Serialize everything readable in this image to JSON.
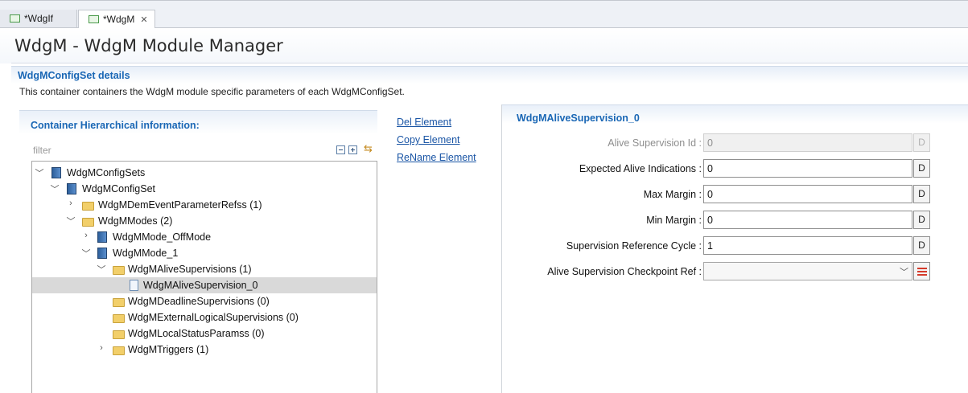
{
  "tabs": [
    {
      "label": "*WdgIf",
      "active": false
    },
    {
      "label": "*WdgM",
      "active": true
    }
  ],
  "page_title": "WdgM - WdgM Module Manager",
  "section": {
    "title": "WdgMConfigSet details",
    "description": "This container containers the WdgM module specific parameters of each WdgMConfigSet."
  },
  "hierarchy": {
    "title": "Container Hierarchical information:",
    "filter_placeholder": "filter",
    "tree": [
      {
        "label": "WdgMConfigSets",
        "icon": "module-icon",
        "expander": "expanded"
      },
      {
        "label": "WdgMConfigSet",
        "icon": "module-icon",
        "expander": "expanded"
      },
      {
        "label": "WdgMDemEventParameterRefss (1)",
        "icon": "folder-icon",
        "expander": "collapsed"
      },
      {
        "label": "WdgMModes (2)",
        "icon": "folder-icon",
        "expander": "expanded"
      },
      {
        "label": "WdgMMode_OffMode",
        "icon": "module-icon",
        "expander": "collapsed"
      },
      {
        "label": "WdgMMode_1",
        "icon": "module-icon",
        "expander": "expanded"
      },
      {
        "label": "WdgMAliveSupervisions (1)",
        "icon": "folder-icon",
        "expander": "expanded"
      },
      {
        "label": "WdgMAliveSupervision_0",
        "icon": "document-icon",
        "expander": "none",
        "selected": true
      },
      {
        "label": "WdgMDeadlineSupervisions (0)",
        "icon": "folder-icon",
        "expander": "none"
      },
      {
        "label": "WdgMExternalLogicalSupervisions (0)",
        "icon": "folder-icon",
        "expander": "none"
      },
      {
        "label": "WdgMLocalStatusParamss (0)",
        "icon": "folder-icon",
        "expander": "none"
      },
      {
        "label": "WdgMTriggers (1)",
        "icon": "folder-icon",
        "expander": "collapsed"
      }
    ]
  },
  "actions": {
    "del": "Del Element",
    "copy": "Copy Element",
    "rename": "ReName Element"
  },
  "details": {
    "title": "WdgMAliveSupervision_0",
    "fields": [
      {
        "label": "Alive Supervision Id :",
        "value": "0",
        "enabled": false,
        "button": "D"
      },
      {
        "label": "Expected Alive Indications :",
        "value": "0",
        "enabled": true,
        "button": "D"
      },
      {
        "label": "Max Margin :",
        "value": "0",
        "enabled": true,
        "button": "D"
      },
      {
        "label": "Min Margin :",
        "value": "0",
        "enabled": true,
        "button": "D"
      },
      {
        "label": "Supervision Reference Cycle :",
        "value": "1",
        "enabled": true,
        "button": "D"
      }
    ],
    "ref_field": {
      "label": "Alive Supervision Checkpoint Ref :",
      "value": ""
    }
  }
}
